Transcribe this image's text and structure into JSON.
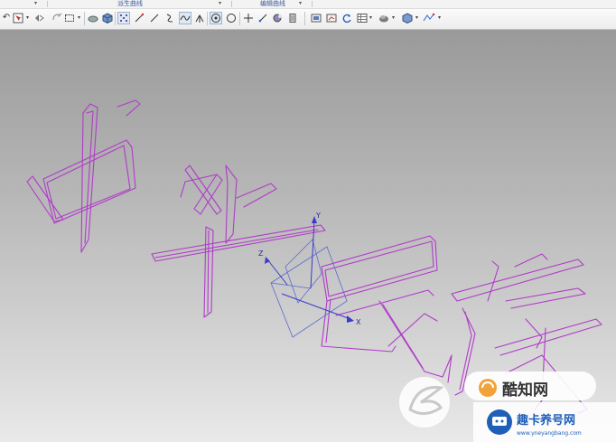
{
  "ribbon_groups": {
    "derived_curves": "派生曲线",
    "edit_curves": "编辑曲线"
  },
  "toolbar_icons": [
    "undo-icon",
    "select-filter-icon",
    "snap-icon",
    "rotate-icon",
    "box-select-icon",
    "shaded-cube-icon",
    "wireframe-cube-icon",
    "point-set-icon",
    "line-icon",
    "arc-icon",
    "spline-icon",
    "studio-spline-icon",
    "intersection-icon",
    "circle-center-icon",
    "circle-icon",
    "point-icon",
    "offset-curve-icon",
    "bridge-curve-icon",
    "trim-curve-icon",
    "curve-length-icon",
    "show-hide-icon",
    "render-icon",
    "refresh-icon",
    "table-icon",
    "layer-icon",
    "view-cube-icon",
    "orient-icon"
  ],
  "canvas": {
    "text": "中华民族",
    "curve_color": "#b03cc8",
    "background_top": "#9a9a9a",
    "background_bottom": "#e9e9e9"
  },
  "csys": {
    "x_label": "X",
    "y_label": "Y",
    "z_label": "Z",
    "axis_color": "#3a3acc",
    "frame_color": "#5a6ad0"
  },
  "watermarks": {
    "logo1_text": "酷知网",
    "logo2_text": "趣卡养号网",
    "logo2_url": "www.yneyangbang.com"
  }
}
